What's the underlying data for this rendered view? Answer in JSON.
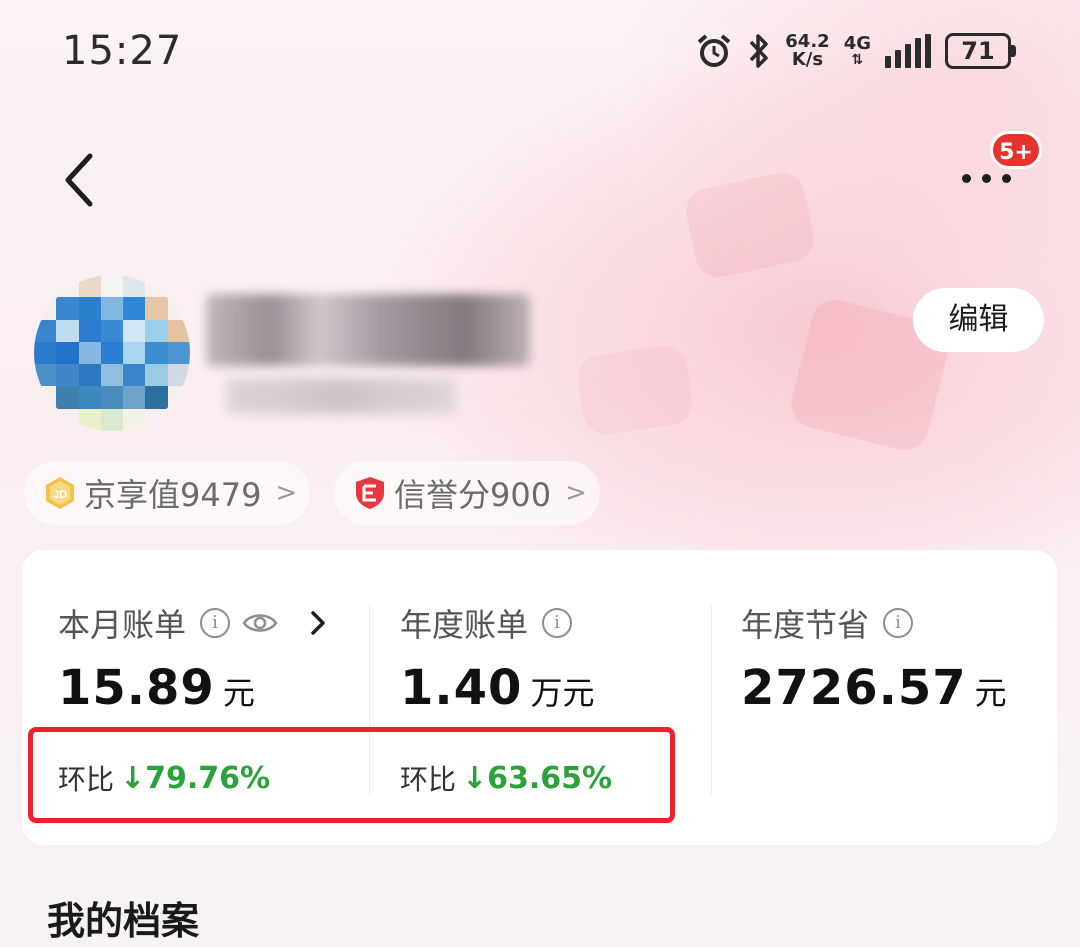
{
  "status_bar": {
    "time": "15:27",
    "speed_value": "64.2",
    "speed_unit": "K/s",
    "network": "4G",
    "battery": "71",
    "icons": [
      "alarm-icon",
      "bluetooth-icon",
      "signal-icon",
      "battery-icon"
    ]
  },
  "nav": {
    "back_icon": "chevron-left-icon",
    "more_icon": "more-dots-icon",
    "notification_badge": "5+"
  },
  "profile": {
    "edit_label": "编辑"
  },
  "pills": [
    {
      "icon": "jd-coin-icon",
      "label": "京享值9479"
    },
    {
      "icon": "credit-shield-icon",
      "label": "信誉分900"
    }
  ],
  "bill_card": {
    "monthly": {
      "label": "本月账单",
      "amount": "15.89",
      "unit": "元",
      "mom_label": "环比",
      "mom_value": "↓79.76%"
    },
    "yearly": {
      "label": "年度账单",
      "amount": "1.40",
      "unit": "万元",
      "mom_label": "环比",
      "mom_value": "↓63.65%"
    },
    "savings": {
      "label": "年度节省",
      "amount": "2726.57",
      "unit": "元"
    },
    "info_icon_glyph": "i",
    "highlight_color": "#e8242a",
    "positive_color": "#2aa33b"
  },
  "section": {
    "title": "我的档案"
  }
}
